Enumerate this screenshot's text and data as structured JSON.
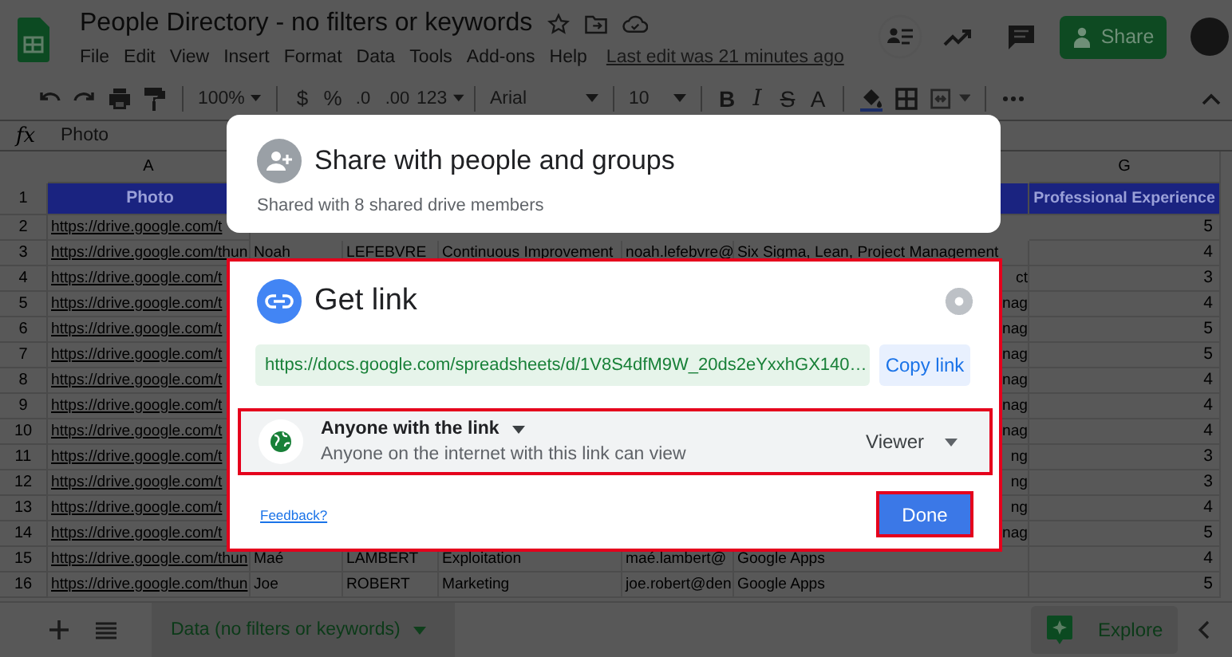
{
  "app": {
    "title": "People Directory - no filters or keywords",
    "menu": [
      "File",
      "Edit",
      "View",
      "Insert",
      "Format",
      "Data",
      "Tools",
      "Add-ons",
      "Help"
    ],
    "last_edit": "Last edit was 21 minutes ago",
    "share_button": "Share"
  },
  "toolbar": {
    "zoom": "100%",
    "currency": "$",
    "percent": "%",
    "decimal_less": ".0",
    "decimal_more": ".00",
    "number_format": "123",
    "font": "Arial",
    "font_size": "10",
    "bold": "B",
    "italic": "I",
    "strikethrough": "S",
    "text_color": "A"
  },
  "formula_bar": {
    "fx": "fx",
    "value": "Photo"
  },
  "sheet": {
    "column_a": {
      "letter": "A"
    },
    "column_g": {
      "letter": "G"
    },
    "header_row": {
      "number": "1",
      "a": "Photo",
      "g": "Professional Experience"
    },
    "rows": [
      {
        "number": "2",
        "a": "https://drive.google.com/t",
        "g": "5"
      },
      {
        "number": "3",
        "a": "https://drive.google.com/thun",
        "b": "Noah",
        "c": "LEFEBVRE",
        "d": "Continuous Improvement",
        "e": "noah.lefebvre@",
        "f": "Six Sigma, Lean, Project Management",
        "g": "4"
      },
      {
        "number": "4",
        "a": "https://drive.google.com/t",
        "f_visible_end": "ct",
        "g": "3"
      },
      {
        "number": "5",
        "a": "https://drive.google.com/t",
        "f_visible_end": "nag",
        "g": "4"
      },
      {
        "number": "6",
        "a": "https://drive.google.com/t",
        "f_visible_end": "nag",
        "g": "5"
      },
      {
        "number": "7",
        "a": "https://drive.google.com/t",
        "f_visible_end": "nag",
        "g": "5"
      },
      {
        "number": "8",
        "a": "https://drive.google.com/t",
        "f_visible_end": "nag",
        "g": "4"
      },
      {
        "number": "9",
        "a": "https://drive.google.com/t",
        "f_visible_end": "nag",
        "g": "4"
      },
      {
        "number": "10",
        "a": "https://drive.google.com/t",
        "f_visible_end": "nag",
        "g": "4"
      },
      {
        "number": "11",
        "a": "https://drive.google.com/t",
        "f_visible_end": "ng",
        "g": "3"
      },
      {
        "number": "12",
        "a": "https://drive.google.com/t",
        "f_visible_end": "ng",
        "g": "3"
      },
      {
        "number": "13",
        "a": "https://drive.google.com/t",
        "f_visible_end": "ng",
        "g": "4"
      },
      {
        "number": "14",
        "a": "https://drive.google.com/t",
        "f_visible_end": "nag",
        "g": "5"
      },
      {
        "number": "15",
        "a": "https://drive.google.com/thun",
        "b": "Maé",
        "c": "LAMBERT",
        "d": "Exploitation",
        "e": "maé.lambert@",
        "f": "Google Apps",
        "g": "4"
      },
      {
        "number": "16",
        "a": "https://drive.google.com/thun",
        "b": "Joe",
        "c": "ROBERT",
        "d": "Marketing",
        "e": "joe.robert@den",
        "f": "Google Apps",
        "g": "5"
      }
    ]
  },
  "sheet_tabs": [
    {
      "label": "Data (no filters or keywords)",
      "selected": true
    }
  ],
  "explore_button": "Explore",
  "share_dialog": {
    "title": "Share with people and groups",
    "subtitle": "Shared with 8 shared drive members"
  },
  "link_dialog": {
    "title": "Get link",
    "highlighted": true,
    "url": "https://docs.google.com/spreadsheets/d/1V8S4dfM9W_20ds2eYxxhGX140…",
    "copy_button": "Copy link",
    "access": {
      "scope": "Anyone with the link",
      "description": "Anyone on the internet with this link can view",
      "role": "Viewer",
      "highlighted": true
    },
    "feedback_link": "Feedback?",
    "done_button": {
      "label": "Done",
      "highlighted": true
    }
  }
}
